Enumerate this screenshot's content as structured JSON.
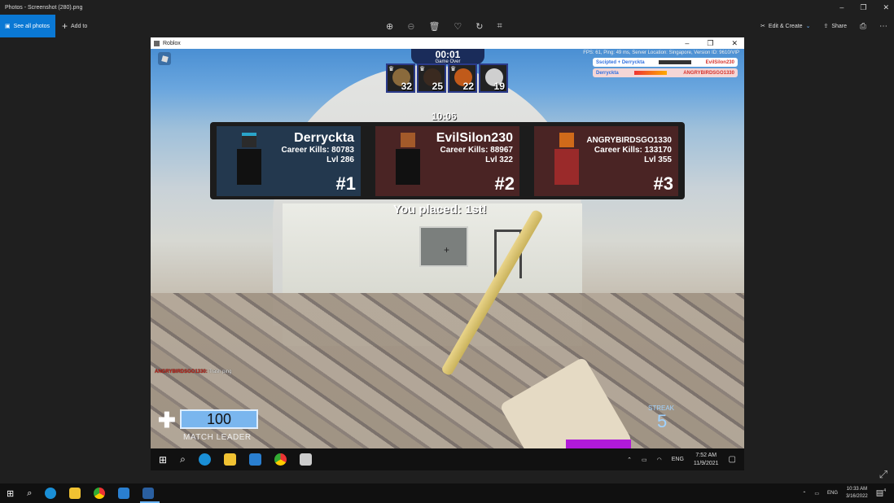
{
  "photos": {
    "title": "Photos - Screenshot (280).png",
    "see_all": "See all photos",
    "add_to": "Add to",
    "edit_create": "Edit & Create",
    "share": "Share"
  },
  "roblox": {
    "window_title": "Roblox",
    "timer": "00:01",
    "game_over": "Game Over",
    "top_players": [
      {
        "score": "32"
      },
      {
        "score": "25"
      },
      {
        "score": "22"
      },
      {
        "score": "19"
      }
    ],
    "server_info": "FPS: 61, Ping: 49 ms, Server Location: Singapore, Version ID: 9610/VIP",
    "killfeed": [
      {
        "left": "Sscipted + Derryckta",
        "right": "EvilSilon230"
      },
      {
        "left": "Derryckta",
        "right": "ANGRYBIRDSGO1330"
      }
    ],
    "sub_timer": "10:06",
    "podium": [
      {
        "name": "Derryckta",
        "kills": "Career Kills: 80783",
        "lvl": "Lvl 286",
        "rank": "#1"
      },
      {
        "name": "EvilSilon230",
        "kills": "Career Kills: 88967",
        "lvl": "Lvl 322",
        "rank": "#2"
      },
      {
        "name": "ANGRYBIRDSGO1330",
        "kills": "Career Kills: 133170",
        "lvl": "Lvl 355",
        "rank": "#3"
      }
    ],
    "placed": "You placed: 1st!",
    "chat": {
      "user": "ANGRYBIRDSGO1330:",
      "message": "Trash ping"
    },
    "health": "100",
    "match_leader": "MATCH LEADER",
    "streak_label": "STREAK",
    "streak_value": "5"
  },
  "inner_taskbar": {
    "lang": "ENG",
    "time": "7:52 AM",
    "date": "11/9/2021"
  },
  "os_taskbar": {
    "lang": "ENG",
    "time": "10:33 AM",
    "date": "3/16/2022",
    "notif_count": "4"
  }
}
